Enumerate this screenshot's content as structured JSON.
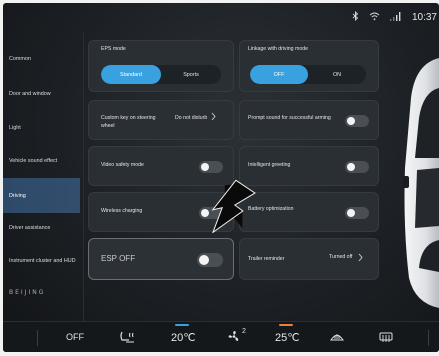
{
  "status": {
    "bluetooth_icon": "bluetooth-icon",
    "wifi_icon": "wifi-icon",
    "signal_icon": "signal-icon",
    "time": "10:37"
  },
  "sidebar": {
    "items": [
      {
        "label": "Common"
      },
      {
        "label": "Door and window"
      },
      {
        "label": "Light"
      },
      {
        "label": "Vehicle sound effect"
      },
      {
        "label": "Driving"
      },
      {
        "label": "Driver assistance"
      },
      {
        "label": "Instrument cluster and HUD"
      }
    ],
    "active_index": 4,
    "brand_logo": "BEIJING"
  },
  "settings": {
    "eps_mode": {
      "label": "EPS mode",
      "options": [
        "Standard",
        "Sports"
      ],
      "selected": "Standard"
    },
    "linkage": {
      "label": "Linkage with driving mode",
      "options": [
        "OFF",
        "ON"
      ],
      "selected": "OFF"
    },
    "custom_key": {
      "label": "Custom key on steering wheel",
      "value": "Do not disturb"
    },
    "prompt_sound": {
      "label": "Prompt sound for successful arming"
    },
    "video_safety": {
      "label": "Video safety mode"
    },
    "intelligent_greeting": {
      "label": "Intelligent greeting"
    },
    "wireless_charging": {
      "label": "Wireless charging"
    },
    "battery_optimization": {
      "label": "Battery optimization"
    },
    "esp_off": {
      "label": "ESP OFF"
    },
    "trailer_reminder": {
      "label": "Trailer reminder",
      "value": "Turned off"
    }
  },
  "bottombar": {
    "off_label": "OFF",
    "seat_heat_icon": "seat-heat-icon",
    "temp_left": "20℃",
    "fan_icon": "fan-icon",
    "fan_level": "2",
    "temp_right": "25℃",
    "front_defrost_icon": "front-defrost-icon",
    "rear_defrost_icon": "rear-defrost-icon",
    "temp_left_color": "#3aa1e0",
    "temp_right_color": "#e8823a"
  }
}
